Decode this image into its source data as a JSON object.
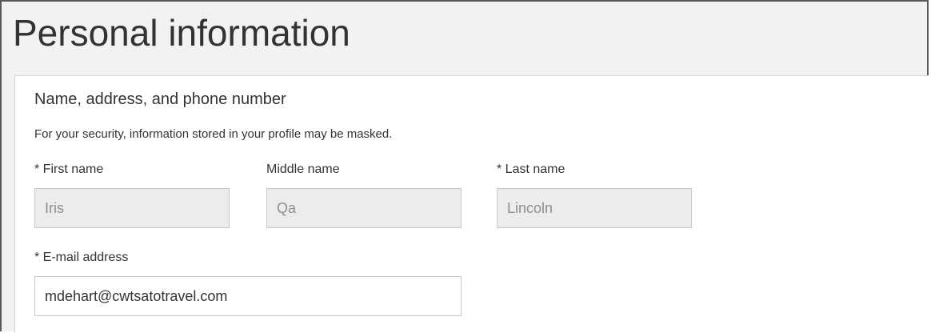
{
  "page": {
    "title": "Personal information"
  },
  "section": {
    "title": "Name, address, and phone number",
    "security_note": "For your security, information stored in your profile may be masked."
  },
  "fields": {
    "first_name": {
      "label": "* First name",
      "value": "Iris",
      "readonly": true
    },
    "middle_name": {
      "label": "Middle name",
      "value": "Qa",
      "readonly": true
    },
    "last_name": {
      "label": "* Last name",
      "value": "Lincoln",
      "readonly": true
    },
    "email": {
      "label": "* E-mail address",
      "value": "mdehart@cwtsatotravel.com",
      "readonly": false
    }
  }
}
